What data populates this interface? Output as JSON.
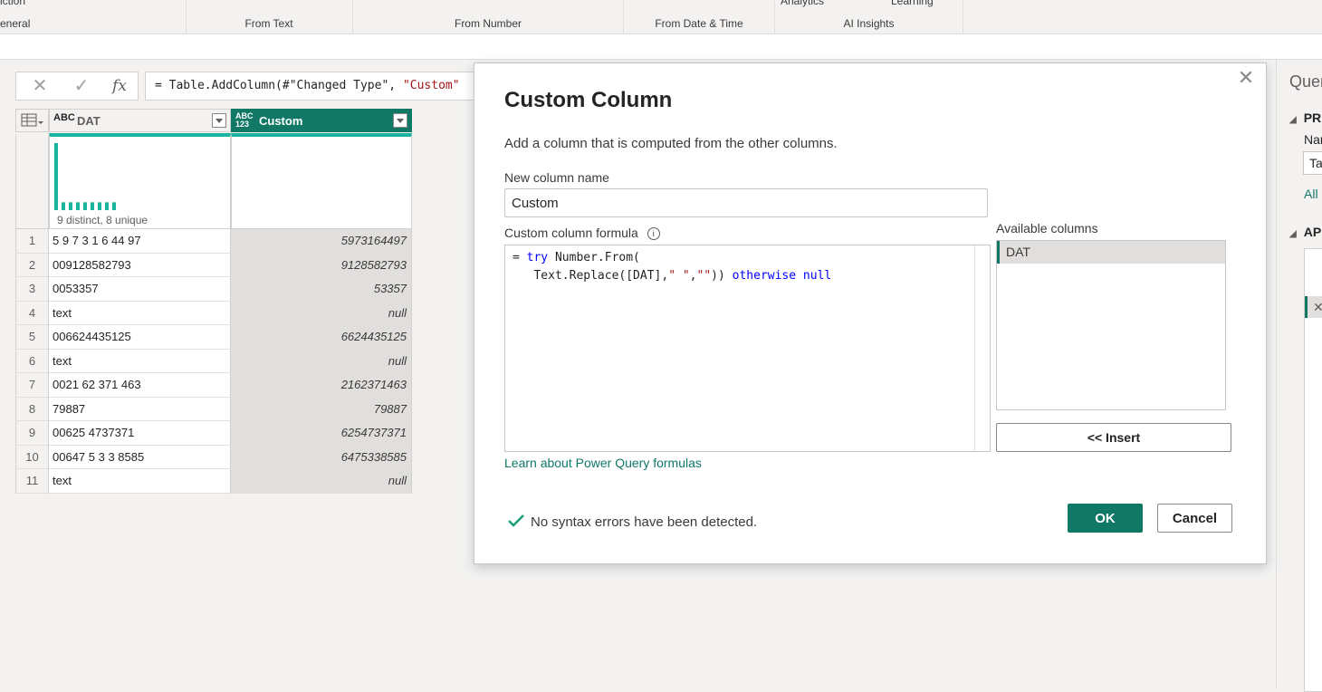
{
  "ribbon": {
    "groups": [
      "eneral",
      "From Text",
      "From Number",
      "From Date & Time",
      "AI Insights"
    ],
    "top_fragments": [
      "iction",
      "Analytics",
      "Learning"
    ]
  },
  "formula_bar": {
    "cancel_icon": "x-icon",
    "confirm_icon": "check-icon",
    "fx_label": "fx",
    "formula_prefix": "= Table.AddColumn(#\"Changed Type\", ",
    "formula_string": "\"Custom\""
  },
  "table": {
    "columns": [
      {
        "type": "ABC",
        "name": "DAT"
      },
      {
        "type": "ABC 123",
        "name": "Custom"
      }
    ],
    "profile_text": "9 distinct, 8 unique",
    "rows": [
      {
        "n": "1",
        "dat": "5 9 7 3 1 6 44 97",
        "custom": "5973164497"
      },
      {
        "n": "2",
        "dat": "009128582793",
        "custom": "9128582793"
      },
      {
        "n": "3",
        "dat": "0053357",
        "custom": "53357"
      },
      {
        "n": "4",
        "dat": "text",
        "custom": "null"
      },
      {
        "n": "5",
        "dat": "006624435125",
        "custom": "6624435125"
      },
      {
        "n": "6",
        "dat": "text",
        "custom": "null"
      },
      {
        "n": "7",
        "dat": "0021 62 371 463",
        "custom": "2162371463"
      },
      {
        "n": "8",
        "dat": "79887",
        "custom": "79887"
      },
      {
        "n": "9",
        "dat": "00625 4737371",
        "custom": "6254737371"
      },
      {
        "n": "10",
        "dat": "00647 5 3 3 8585",
        "custom": "6475338585"
      },
      {
        "n": "11",
        "dat": "text",
        "custom": "null"
      }
    ]
  },
  "right_panel": {
    "title": "Quer",
    "section1": "PR",
    "name_label": "Nar",
    "name_value": "Ta",
    "all_link": "All",
    "section2": "AP"
  },
  "dialog": {
    "title": "Custom Column",
    "description": "Add a column that is computed from the other columns.",
    "name_label": "New column name",
    "name_value": "Custom",
    "formula_label": "Custom column formula",
    "formula": {
      "eq": "= ",
      "try": "try",
      "part1": " Number.From(",
      "part2": "   Text.Replace([DAT],",
      "s1": "\" \"",
      "comma": ",",
      "s2": "\"\"",
      "close": "))",
      "otherwise": "otherwise",
      "null": "null"
    },
    "available_label": "Available columns",
    "available_columns": [
      "DAT"
    ],
    "insert_label": "<< Insert",
    "learn_link": "Learn about Power Query formulas",
    "status": "No syntax errors have been detected.",
    "ok_label": "OK",
    "cancel_label": "Cancel"
  },
  "colors": {
    "accent": "#117865",
    "profile_bar": "#1ab39f",
    "keyword": "#0000ff",
    "string": "#a31515"
  }
}
